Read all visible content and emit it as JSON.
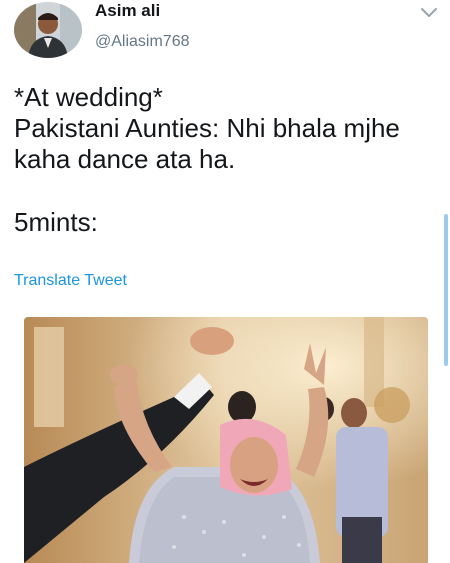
{
  "tweet": {
    "display_name": "Asim ali",
    "handle": "@Aliasim768",
    "lines": [
      "*At wedding*",
      "Pakistani Aunties: Nhi bhala mjhe",
      "kaha dance ata ha.",
      "5mints:"
    ],
    "translate_label": "Translate Tweet"
  },
  "icons": {
    "avatar": "profile-avatar",
    "menu": "chevron-down-icon"
  },
  "colors": {
    "text": "#14171a",
    "secondary": "#657786",
    "link": "#1b95e0"
  }
}
